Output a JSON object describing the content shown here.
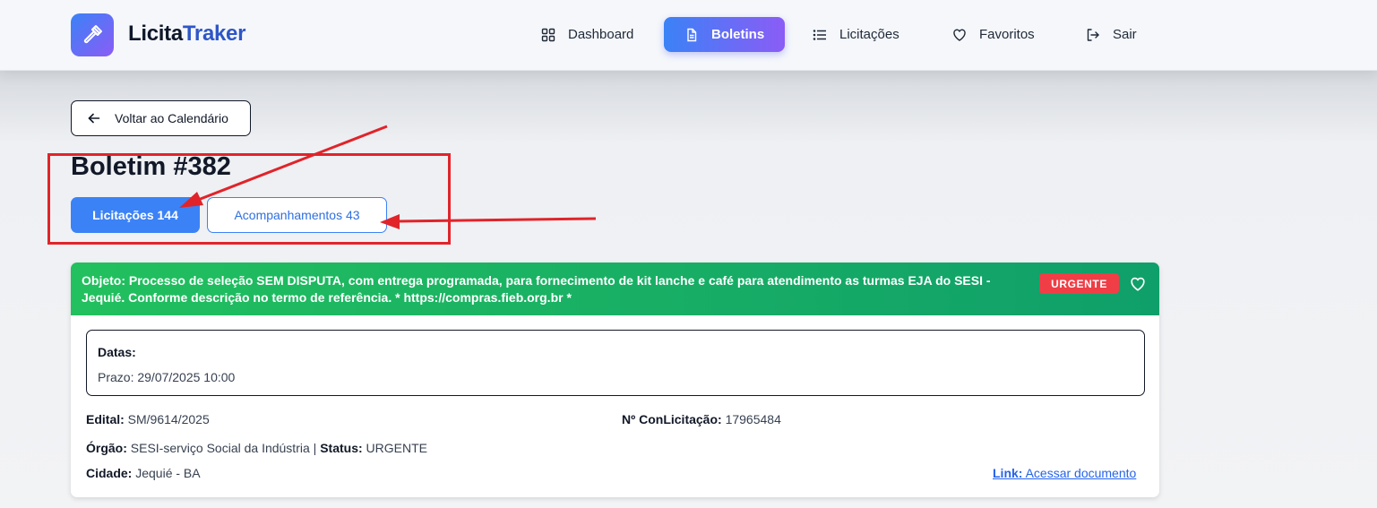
{
  "header": {
    "brand_primary": "Licita",
    "brand_accent": "Traker",
    "nav": [
      {
        "label": "Dashboard",
        "icon": "grid-icon"
      },
      {
        "label": "Boletins",
        "icon": "document-icon",
        "active": true
      },
      {
        "label": "Licitações",
        "icon": "list-icon"
      },
      {
        "label": "Favoritos",
        "icon": "heart-icon"
      },
      {
        "label": "Sair",
        "icon": "logout-icon"
      }
    ]
  },
  "back_button": {
    "label": "Voltar ao Calendário",
    "icon": "arrow-left-icon"
  },
  "page_title": "Boletim #382",
  "tabs": [
    {
      "label": "Licitações 144",
      "active": true
    },
    {
      "label": "Acompanhamentos 43",
      "active": false
    }
  ],
  "card": {
    "object_label": "Objeto:",
    "object_text": "Processo de seleção SEM DISPUTA, com entrega programada, para fornecimento de kit lanche e café para atendimento as turmas EJA do SESI - Jequié. Conforme descrição no termo de referência. * https://compras.fieb.org.br *",
    "badge": "URGENTE",
    "dates_label": "Datas:",
    "deadline": "Prazo: 29/07/2025 10:00",
    "edital_label": "Edital:",
    "edital_value": "SM/9614/2025",
    "conlicitacao_label": "Nº ConLicitação:",
    "conlicitacao_value": "17965484",
    "orgao_label": "Órgão:",
    "orgao_value": "SESI-serviço Social da Indústria |",
    "status_label": "Status:",
    "status_value": "URGENTE",
    "cidade_label": "Cidade:",
    "cidade_value": "Jequié - BA",
    "link_label": "Link:",
    "link_value": "Acessar documento"
  },
  "colors": {
    "accent_blue": "#3b82f6",
    "accent_purple": "#8b5cf6",
    "card_header_green": "#16a865",
    "urgent_red": "#ef3e46",
    "annotation_red": "#e0242a"
  }
}
